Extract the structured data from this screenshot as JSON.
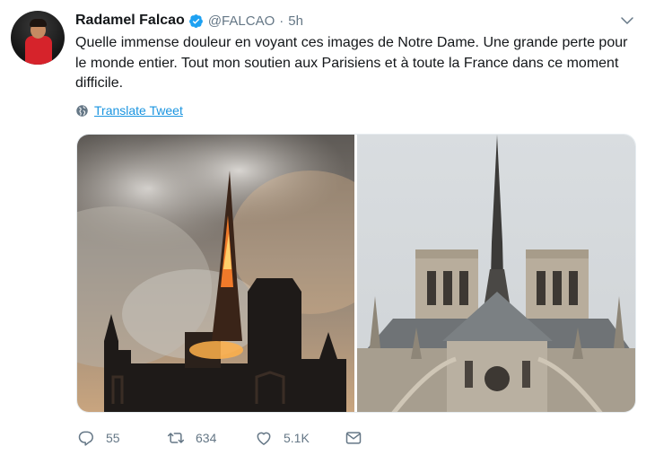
{
  "tweet": {
    "author_name": "Radamel Falcao",
    "handle": "@FALCAO",
    "separator": "·",
    "time": "5h",
    "text": "Quelle immense douleur en voyant ces images de Notre Dame. Une grande perte pour le monde entier. Tout mon soutien aux Parisiens et à toute la France dans ce moment difficile.",
    "translate_label": "Translate Tweet"
  },
  "actions": {
    "replies": "55",
    "retweets": "634",
    "likes": "5.1K"
  },
  "icons": {
    "verified": "verified-badge-icon",
    "caret": "chevron-down-icon",
    "translate": "globe-icon",
    "reply": "reply-icon",
    "retweet": "retweet-icon",
    "like": "heart-icon",
    "message": "envelope-icon"
  },
  "colors": {
    "link": "#1b95e0",
    "secondary_text": "#657786",
    "primary_text": "#14171a",
    "verified": "#1da1f2"
  }
}
